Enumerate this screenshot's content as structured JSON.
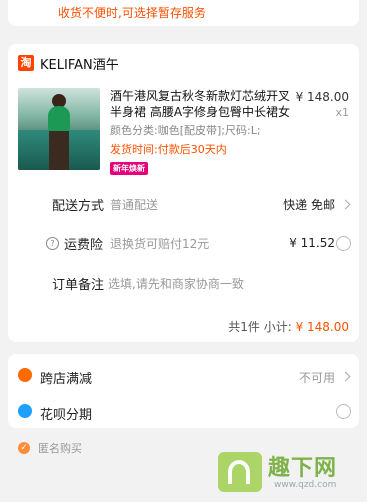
{
  "top_notice": "收货不便时,可选择暂存服务",
  "shop": {
    "name": "KELIFAN酒午",
    "logo_char": "淘",
    "product": {
      "title": "酒午港风复古秋冬新款灯芯绒开叉半身裙 高腰A字修身包臀中长裙女",
      "spec": "颜色分类:咖色[配皮带];尺码:L;",
      "ship_time": "发货时间:付款后30天内",
      "badge": "新年焕新",
      "price": "¥ 148.00",
      "qty": "x1"
    },
    "delivery": {
      "label": "配送方式",
      "value": "普通配送",
      "right": "快递 免邮"
    },
    "insurance": {
      "label": "运费险",
      "value": "退换货可赔付12元",
      "price": "¥ 11.52",
      "help_icon": "?"
    },
    "note": {
      "label": "订单备注",
      "placeholder": "选填,请先和商家协商一致"
    },
    "subtotal": {
      "count_text": "共1件",
      "label": "小计:",
      "amount": "¥ 148.00"
    }
  },
  "discounts": {
    "cross_store": {
      "label": "跨店满减",
      "status": "不可用"
    },
    "huabei": {
      "label": "花呗分期"
    }
  },
  "anonymous": {
    "label": "匿名购买",
    "checked": true
  },
  "watermark": {
    "text": "趣下网",
    "url": "www.qzd.com"
  },
  "colors": {
    "accent": "#ff5000",
    "cross_store_icon": "#ff6a00",
    "huabei_icon": "#1ea0ff"
  }
}
